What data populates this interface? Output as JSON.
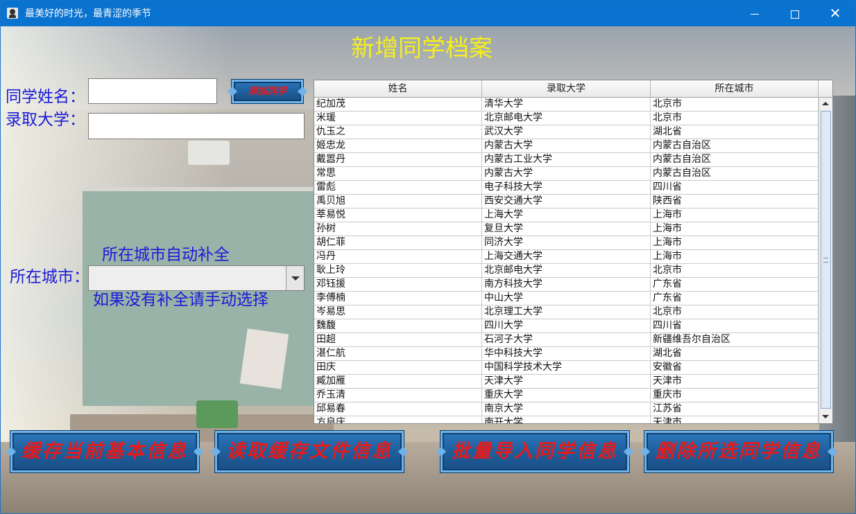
{
  "window": {
    "title": "最美好的时光，最青涩的季节",
    "app_icon": "person-icon",
    "controls": {
      "minimize": "minimize-icon",
      "maximize": "maximize-icon",
      "close": "✕"
    }
  },
  "heading": "新增同学档案",
  "form": {
    "name_label": "同学姓名：",
    "name_value": "",
    "add_button": "添加同学",
    "univ_label": "录取大学：",
    "univ_value": "",
    "city_label": "所在城市：",
    "city_value": "",
    "hint_auto": "所在城市自动补全",
    "hint_manual": "如果没有补全请手动选择"
  },
  "table": {
    "columns": [
      "姓名",
      "录取大学",
      "所在城市"
    ],
    "rows": [
      [
        "纪加茂",
        "清华大学",
        "北京市"
      ],
      [
        "米瑗",
        "北京邮电大学",
        "北京市"
      ],
      [
        "仇玉之",
        "武汉大学",
        "湖北省"
      ],
      [
        "姬忠龙",
        "内蒙古大学",
        "内蒙古自治区"
      ],
      [
        "戴嚣丹",
        "内蒙古工业大学",
        "内蒙古自治区"
      ],
      [
        "常思",
        "内蒙古大学",
        "内蒙古自治区"
      ],
      [
        "雷彪",
        "电子科技大学",
        "四川省"
      ],
      [
        "禹贝旭",
        "西安交通大学",
        "陕西省"
      ],
      [
        "莘易悦",
        "上海大学",
        "上海市"
      ],
      [
        "孙树",
        "复旦大学",
        "上海市"
      ],
      [
        "胡仁菲",
        "同济大学",
        "上海市"
      ],
      [
        "冯丹",
        "上海交通大学",
        "上海市"
      ],
      [
        "耿上玲",
        "北京邮电大学",
        "北京市"
      ],
      [
        "邓钰援",
        "南方科技大学",
        "广东省"
      ],
      [
        "李傅楠",
        "中山大学",
        "广东省"
      ],
      [
        "岑易思",
        "北京理工大学",
        "北京市"
      ],
      [
        "魏馥",
        "四川大学",
        "四川省"
      ],
      [
        "田超",
        "石河子大学",
        "新疆维吾尔自治区"
      ],
      [
        "湛仁航",
        "华中科技大学",
        "湖北省"
      ],
      [
        "田庆",
        "中国科学技术大学",
        "安徽省"
      ],
      [
        "臧加雁",
        "天津大学",
        "天津市"
      ],
      [
        "乔玉清",
        "重庆大学",
        "重庆市"
      ],
      [
        "邱易春",
        "南京大学",
        "江苏省"
      ],
      [
        "方良庆",
        "南开大学",
        "天津市"
      ]
    ]
  },
  "buttons": {
    "save_cache": "缓存当前基本信息",
    "read_cache": "读取缓存文件信息",
    "batch_import": "批量导入同学信息",
    "delete_selected": "删除所选同学信息"
  },
  "colors": {
    "titlebar": "#0a72cf",
    "heading": "#f7ef1c",
    "label": "#1a1ad8",
    "button_text": "#e81a1a",
    "button_bg": "#1f5e9c"
  }
}
